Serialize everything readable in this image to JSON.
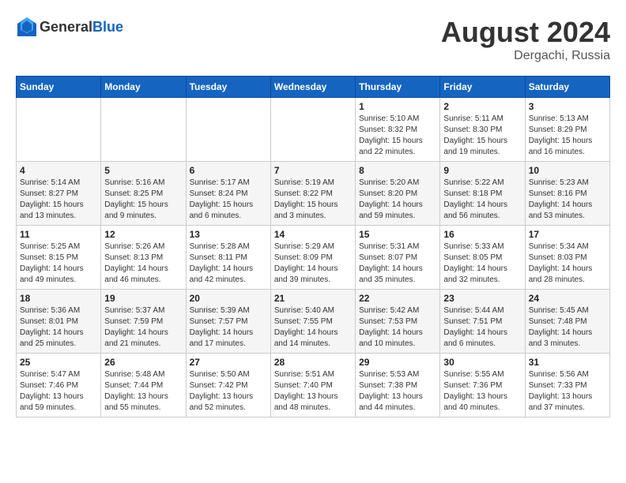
{
  "header": {
    "logo_general": "General",
    "logo_blue": "Blue",
    "main_title": "August 2024",
    "subtitle": "Dergachi, Russia"
  },
  "weekdays": [
    "Sunday",
    "Monday",
    "Tuesday",
    "Wednesday",
    "Thursday",
    "Friday",
    "Saturday"
  ],
  "weeks": [
    [
      {
        "day": "",
        "info": ""
      },
      {
        "day": "",
        "info": ""
      },
      {
        "day": "",
        "info": ""
      },
      {
        "day": "",
        "info": ""
      },
      {
        "day": "1",
        "info": "Sunrise: 5:10 AM\nSunset: 8:32 PM\nDaylight: 15 hours\nand 22 minutes."
      },
      {
        "day": "2",
        "info": "Sunrise: 5:11 AM\nSunset: 8:30 PM\nDaylight: 15 hours\nand 19 minutes."
      },
      {
        "day": "3",
        "info": "Sunrise: 5:13 AM\nSunset: 8:29 PM\nDaylight: 15 hours\nand 16 minutes."
      }
    ],
    [
      {
        "day": "4",
        "info": "Sunrise: 5:14 AM\nSunset: 8:27 PM\nDaylight: 15 hours\nand 13 minutes."
      },
      {
        "day": "5",
        "info": "Sunrise: 5:16 AM\nSunset: 8:25 PM\nDaylight: 15 hours\nand 9 minutes."
      },
      {
        "day": "6",
        "info": "Sunrise: 5:17 AM\nSunset: 8:24 PM\nDaylight: 15 hours\nand 6 minutes."
      },
      {
        "day": "7",
        "info": "Sunrise: 5:19 AM\nSunset: 8:22 PM\nDaylight: 15 hours\nand 3 minutes."
      },
      {
        "day": "8",
        "info": "Sunrise: 5:20 AM\nSunset: 8:20 PM\nDaylight: 14 hours\nand 59 minutes."
      },
      {
        "day": "9",
        "info": "Sunrise: 5:22 AM\nSunset: 8:18 PM\nDaylight: 14 hours\nand 56 minutes."
      },
      {
        "day": "10",
        "info": "Sunrise: 5:23 AM\nSunset: 8:16 PM\nDaylight: 14 hours\nand 53 minutes."
      }
    ],
    [
      {
        "day": "11",
        "info": "Sunrise: 5:25 AM\nSunset: 8:15 PM\nDaylight: 14 hours\nand 49 minutes."
      },
      {
        "day": "12",
        "info": "Sunrise: 5:26 AM\nSunset: 8:13 PM\nDaylight: 14 hours\nand 46 minutes."
      },
      {
        "day": "13",
        "info": "Sunrise: 5:28 AM\nSunset: 8:11 PM\nDaylight: 14 hours\nand 42 minutes."
      },
      {
        "day": "14",
        "info": "Sunrise: 5:29 AM\nSunset: 8:09 PM\nDaylight: 14 hours\nand 39 minutes."
      },
      {
        "day": "15",
        "info": "Sunrise: 5:31 AM\nSunset: 8:07 PM\nDaylight: 14 hours\nand 35 minutes."
      },
      {
        "day": "16",
        "info": "Sunrise: 5:33 AM\nSunset: 8:05 PM\nDaylight: 14 hours\nand 32 minutes."
      },
      {
        "day": "17",
        "info": "Sunrise: 5:34 AM\nSunset: 8:03 PM\nDaylight: 14 hours\nand 28 minutes."
      }
    ],
    [
      {
        "day": "18",
        "info": "Sunrise: 5:36 AM\nSunset: 8:01 PM\nDaylight: 14 hours\nand 25 minutes."
      },
      {
        "day": "19",
        "info": "Sunrise: 5:37 AM\nSunset: 7:59 PM\nDaylight: 14 hours\nand 21 minutes."
      },
      {
        "day": "20",
        "info": "Sunrise: 5:39 AM\nSunset: 7:57 PM\nDaylight: 14 hours\nand 17 minutes."
      },
      {
        "day": "21",
        "info": "Sunrise: 5:40 AM\nSunset: 7:55 PM\nDaylight: 14 hours\nand 14 minutes."
      },
      {
        "day": "22",
        "info": "Sunrise: 5:42 AM\nSunset: 7:53 PM\nDaylight: 14 hours\nand 10 minutes."
      },
      {
        "day": "23",
        "info": "Sunrise: 5:44 AM\nSunset: 7:51 PM\nDaylight: 14 hours\nand 6 minutes."
      },
      {
        "day": "24",
        "info": "Sunrise: 5:45 AM\nSunset: 7:48 PM\nDaylight: 14 hours\nand 3 minutes."
      }
    ],
    [
      {
        "day": "25",
        "info": "Sunrise: 5:47 AM\nSunset: 7:46 PM\nDaylight: 13 hours\nand 59 minutes."
      },
      {
        "day": "26",
        "info": "Sunrise: 5:48 AM\nSunset: 7:44 PM\nDaylight: 13 hours\nand 55 minutes."
      },
      {
        "day": "27",
        "info": "Sunrise: 5:50 AM\nSunset: 7:42 PM\nDaylight: 13 hours\nand 52 minutes."
      },
      {
        "day": "28",
        "info": "Sunrise: 5:51 AM\nSunset: 7:40 PM\nDaylight: 13 hours\nand 48 minutes."
      },
      {
        "day": "29",
        "info": "Sunrise: 5:53 AM\nSunset: 7:38 PM\nDaylight: 13 hours\nand 44 minutes."
      },
      {
        "day": "30",
        "info": "Sunrise: 5:55 AM\nSunset: 7:36 PM\nDaylight: 13 hours\nand 40 minutes."
      },
      {
        "day": "31",
        "info": "Sunrise: 5:56 AM\nSunset: 7:33 PM\nDaylight: 13 hours\nand 37 minutes."
      }
    ]
  ]
}
